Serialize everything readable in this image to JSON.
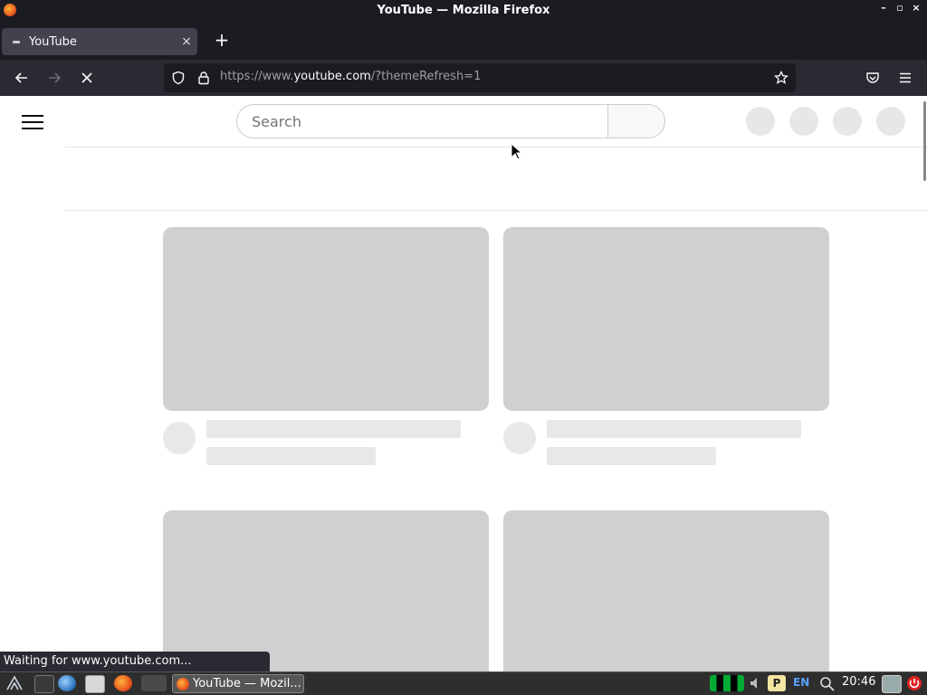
{
  "window": {
    "title": "YouTube — Mozilla Firefox",
    "minimize": "–",
    "maximize": "▫",
    "close": "×"
  },
  "tabs": [
    {
      "title": "YouTube",
      "close_label": "×"
    }
  ],
  "new_tab_label": "+",
  "navbar": {
    "url_prefix": "https://www.",
    "url_host": "youtube.com",
    "url_path": "/?themeRefresh=1"
  },
  "page": {
    "search_placeholder": "Search"
  },
  "status_text": "Waiting for www.youtube.com...",
  "taskbar": {
    "task_label": "YouTube — Mozil...",
    "language": "EN",
    "clock": "20:46"
  },
  "icons": {
    "back": "arrow-left-icon",
    "forward": "arrow-right-icon",
    "stop": "close-icon",
    "shield": "shield-icon",
    "lock": "lock-icon",
    "bookmark": "star-icon",
    "pocket": "pocket-icon",
    "menu": "hamburger-menu-icon"
  },
  "colors": {
    "chrome_dark": "#1c1b22",
    "navbar": "#2b2a33",
    "skeleton": "#d0d0d0",
    "skeleton_light": "#e9e7ea"
  }
}
